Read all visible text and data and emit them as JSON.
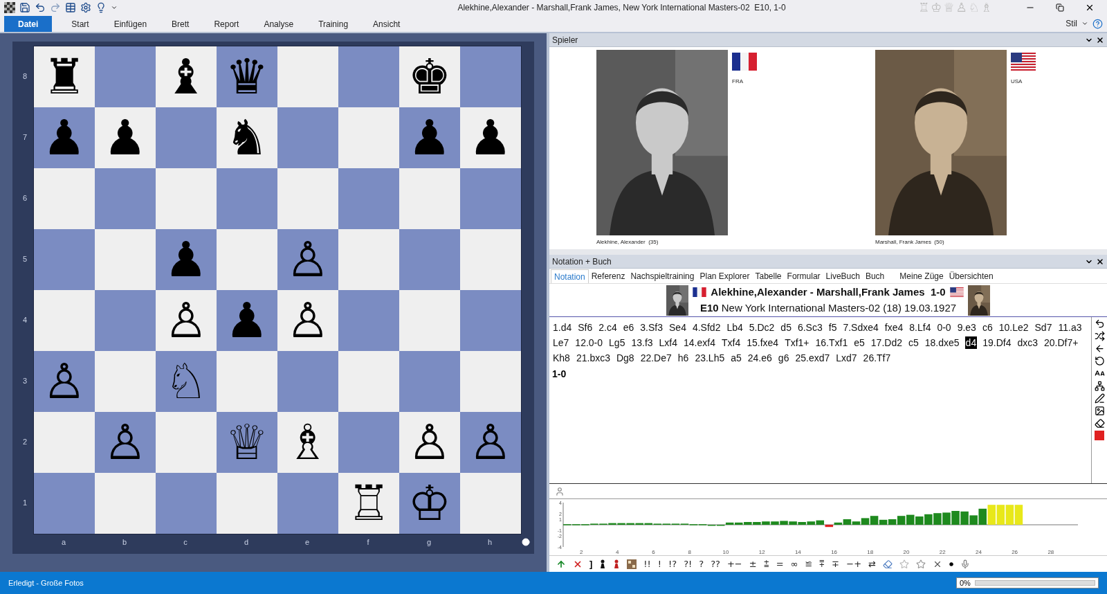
{
  "window": {
    "title": "Alekhine,Alexander - Marshall,Frank James, New York International Masters-02  E10, 1-0",
    "title_glyphs": [
      "♖",
      "♔",
      "♕",
      "♙",
      "♘",
      "♗"
    ]
  },
  "ribbon": {
    "tabs": [
      {
        "label": "Datei",
        "selected": true
      },
      {
        "label": "Start",
        "selected": false
      },
      {
        "label": "Einfügen",
        "selected": false
      },
      {
        "label": "Brett",
        "selected": false
      },
      {
        "label": "Report",
        "selected": false
      },
      {
        "label": "Analyse",
        "selected": false
      },
      {
        "label": "Training",
        "selected": false
      },
      {
        "label": "Ansicht",
        "selected": false
      }
    ],
    "style_label": "Stil"
  },
  "board": {
    "ranks": [
      "8",
      "7",
      "6",
      "5",
      "4",
      "3",
      "2",
      "1"
    ],
    "files": [
      "a",
      "b",
      "c",
      "d",
      "e",
      "f",
      "g",
      "h"
    ],
    "squares": [
      [
        {
          "color": "#efefef",
          "piece": "♜"
        },
        {
          "color": "#7b8cc2"
        },
        {
          "color": "#efefef",
          "piece": "♝"
        },
        {
          "color": "#7b8cc2",
          "piece": "♛"
        },
        {
          "color": "#efefef"
        },
        {
          "color": "#7b8cc2"
        },
        {
          "color": "#efefef",
          "piece": "♚"
        },
        {
          "color": "#7b8cc2"
        }
      ],
      [
        {
          "color": "#7b8cc2",
          "piece": "♟"
        },
        {
          "color": "#efefef",
          "piece": "♟"
        },
        {
          "color": "#7b8cc2"
        },
        {
          "color": "#efefef",
          "piece": "♞"
        },
        {
          "color": "#7b8cc2"
        },
        {
          "color": "#efefef"
        },
        {
          "color": "#7b8cc2",
          "piece": "♟"
        },
        {
          "color": "#efefef",
          "piece": "♟"
        }
      ],
      [
        {
          "color": "#efefef"
        },
        {
          "color": "#7b8cc2"
        },
        {
          "color": "#efefef"
        },
        {
          "color": "#7b8cc2"
        },
        {
          "color": "#efefef"
        },
        {
          "color": "#7b8cc2"
        },
        {
          "color": "#efefef"
        },
        {
          "color": "#7b8cc2"
        }
      ],
      [
        {
          "color": "#7b8cc2"
        },
        {
          "color": "#efefef"
        },
        {
          "color": "#7b8cc2",
          "piece": "♟"
        },
        {
          "color": "#efefef"
        },
        {
          "color": "#7b8cc2",
          "piece": "♙"
        },
        {
          "color": "#efefef"
        },
        {
          "color": "#7b8cc2"
        },
        {
          "color": "#efefef"
        }
      ],
      [
        {
          "color": "#efefef"
        },
        {
          "color": "#7b8cc2"
        },
        {
          "color": "#efefef",
          "piece": "♙"
        },
        {
          "color": "#7b8cc2",
          "piece": "♟"
        },
        {
          "color": "#efefef",
          "piece": "♙"
        },
        {
          "color": "#7b8cc2"
        },
        {
          "color": "#efefef"
        },
        {
          "color": "#7b8cc2"
        }
      ],
      [
        {
          "color": "#7b8cc2",
          "piece": "♙"
        },
        {
          "color": "#efefef"
        },
        {
          "color": "#7b8cc2",
          "piece": "♘"
        },
        {
          "color": "#efefef"
        },
        {
          "color": "#7b8cc2"
        },
        {
          "color": "#efefef"
        },
        {
          "color": "#7b8cc2"
        },
        {
          "color": "#efefef"
        }
      ],
      [
        {
          "color": "#efefef"
        },
        {
          "color": "#7b8cc2",
          "piece": "♙"
        },
        {
          "color": "#efefef"
        },
        {
          "color": "#7b8cc2",
          "piece": "♕"
        },
        {
          "color": "#efefef",
          "piece": "♗"
        },
        {
          "color": "#7b8cc2"
        },
        {
          "color": "#efefef",
          "piece": "♙"
        },
        {
          "color": "#7b8cc2",
          "piece": "♙"
        }
      ],
      [
        {
          "color": "#7b8cc2"
        },
        {
          "color": "#efefef"
        },
        {
          "color": "#7b8cc2"
        },
        {
          "color": "#efefef"
        },
        {
          "color": "#7b8cc2"
        },
        {
          "color": "#efefef",
          "piece": "♖"
        },
        {
          "color": "#7b8cc2",
          "piece": "♔"
        },
        {
          "color": "#efefef"
        }
      ]
    ]
  },
  "players_panel": {
    "title": "Spieler",
    "players": [
      {
        "caption": "Alekhine, Alexander  (35)",
        "country": "FRA",
        "flag": {
          "kind": "france"
        }
      },
      {
        "caption": "Marshall, Frank James  (50)",
        "country": "USA",
        "flag": {
          "kind": "usa"
        }
      }
    ]
  },
  "notation_panel": {
    "title": "Notation + Buch",
    "tabs": [
      {
        "label": "Notation",
        "selected": true
      },
      {
        "label": "Referenz",
        "selected": false
      },
      {
        "label": "Nachspieltraining",
        "selected": false
      },
      {
        "label": "Plan Explorer",
        "selected": false
      },
      {
        "label": "Tabelle",
        "selected": false
      },
      {
        "label": "Formular",
        "selected": false
      },
      {
        "label": "LiveBuch",
        "selected": false
      },
      {
        "label": "Buch",
        "selected": false
      },
      {
        "label": "Meine Züge",
        "selected": false
      },
      {
        "label": "Übersichten",
        "selected": false
      }
    ],
    "header": {
      "players_line": "Alekhine,Alexander - Marshall,Frank James  1-0",
      "event_line": "**E10** New York International Masters-02 (18) 19.03.1927"
    },
    "moves": [
      {
        "text": "1.d4",
        "selected": false
      },
      {
        "text": "Sf6",
        "selected": false
      },
      {
        "text": "2.c4",
        "selected": false
      },
      {
        "text": "e6",
        "selected": false
      },
      {
        "text": "3.Sf3",
        "selected": false
      },
      {
        "text": "Se4",
        "selected": false
      },
      {
        "text": "4.Sfd2",
        "selected": false
      },
      {
        "text": "Lb4",
        "selected": false
      },
      {
        "text": "5.Dc2",
        "selected": false
      },
      {
        "text": "d5",
        "selected": false
      },
      {
        "text": "6.Sc3",
        "selected": false
      },
      {
        "text": "f5",
        "selected": false
      },
      {
        "text": "7.Sdxe4",
        "selected": false
      },
      {
        "text": "fxe4",
        "selected": false
      },
      {
        "text": "8.Lf4",
        "selected": false
      },
      {
        "text": "0-0",
        "selected": false
      },
      {
        "text": "9.e3",
        "selected": false
      },
      {
        "text": "c6",
        "selected": false
      },
      {
        "text": "10.Le2",
        "selected": false
      },
      {
        "text": "Sd7",
        "selected": false
      },
      {
        "text": "11.a3",
        "selected": false
      },
      {
        "text": "Le7",
        "selected": false
      },
      {
        "text": "12.0-0",
        "selected": false
      },
      {
        "text": "Lg5",
        "selected": false
      },
      {
        "text": "13.f3",
        "selected": false
      },
      {
        "text": "Lxf4",
        "selected": false
      },
      {
        "text": "14.exf4",
        "selected": false
      },
      {
        "text": "Txf4",
        "selected": false
      },
      {
        "text": "15.fxe4",
        "selected": false
      },
      {
        "text": "Txf1+",
        "selected": false
      },
      {
        "text": "16.Txf1",
        "selected": false
      },
      {
        "text": "e5",
        "selected": false
      },
      {
        "text": "17.Dd2",
        "selected": false
      },
      {
        "text": "c5",
        "selected": false
      },
      {
        "text": "18.dxe5",
        "selected": false
      },
      {
        "text": "d4",
        "selected": true
      },
      {
        "text": "19.Df4",
        "selected": false
      },
      {
        "text": "dxc3",
        "selected": false
      },
      {
        "text": "20.Df7+",
        "selected": false
      },
      {
        "text": "Kh8",
        "selected": false
      },
      {
        "text": "21.bxc3",
        "selected": false
      },
      {
        "text": "Dg8",
        "selected": false
      },
      {
        "text": "22.De7",
        "selected": false
      },
      {
        "text": "h6",
        "selected": false
      },
      {
        "text": "23.Lh5",
        "selected": false
      },
      {
        "text": "a5",
        "selected": false
      },
      {
        "text": "24.e6",
        "selected": false
      },
      {
        "text": "g6",
        "selected": false
      },
      {
        "text": "25.exd7",
        "selected": false
      },
      {
        "text": "Lxd7",
        "selected": false
      },
      {
        "text": "26.Tf7",
        "selected": false
      }
    ],
    "result": "1-0"
  },
  "eval_graph": {
    "chart_data": {
      "type": "bar",
      "x": [
        1,
        1.5,
        2,
        2.5,
        3,
        3.5,
        4,
        4.5,
        5,
        5.5,
        6,
        6.5,
        7,
        7.5,
        8,
        8.5,
        9,
        9.5,
        10,
        10.5,
        11,
        11.5,
        12,
        12.5,
        13,
        13.5,
        14,
        14.5,
        15,
        15.5,
        16,
        16.5,
        17,
        17.5,
        18,
        18.5,
        19,
        19.5,
        20,
        20.5,
        21,
        21.5,
        22,
        22.5,
        23,
        23.5,
        24,
        24.5,
        25,
        25.5,
        26
      ],
      "series": [
        {
          "color": "#1e8a1e",
          "values": [
            0.1,
            0.1,
            0.1,
            0.2,
            0.2,
            0.3,
            0.3,
            0.3,
            0.3,
            0.3,
            0.2,
            0.2,
            0.2,
            0.2,
            0.1,
            0.1,
            0.0,
            0.0,
            0.4,
            0.4,
            0.5,
            0.5,
            0.6,
            0.6,
            0.7,
            0.6,
            0.5,
            0.6,
            0.8,
            null,
            0.4,
            1.0,
            0.6,
            1.2,
            1.6,
            0.9,
            1.0,
            1.6,
            1.8,
            1.5,
            1.9,
            2.1,
            2.2,
            2.5,
            2.4,
            1.7,
            2.9,
            null,
            null,
            null,
            null
          ]
        },
        {
          "color": "#e02020",
          "values": [
            null,
            null,
            null,
            null,
            null,
            null,
            null,
            null,
            null,
            null,
            null,
            null,
            null,
            null,
            null,
            null,
            null,
            null,
            null,
            null,
            null,
            null,
            null,
            null,
            null,
            null,
            null,
            null,
            null,
            -0.4,
            null,
            null,
            null,
            null,
            null,
            null,
            null,
            null,
            null,
            null,
            null,
            null,
            null,
            null,
            null,
            null,
            null,
            null,
            null,
            null,
            null
          ]
        },
        {
          "color": "#e8e81a",
          "values": [
            null,
            null,
            null,
            null,
            null,
            null,
            null,
            null,
            null,
            null,
            null,
            null,
            null,
            null,
            null,
            null,
            null,
            null,
            null,
            null,
            null,
            null,
            null,
            null,
            null,
            null,
            null,
            null,
            null,
            null,
            null,
            null,
            null,
            null,
            null,
            null,
            null,
            null,
            null,
            null,
            null,
            null,
            null,
            null,
            null,
            null,
            null,
            3.6,
            3.6,
            3.6,
            3.6
          ]
        }
      ],
      "xlim": [
        1,
        29.5
      ],
      "ylim": [
        -4,
        4
      ],
      "xticks": [
        2,
        4,
        6,
        8,
        10,
        12,
        14,
        16,
        18,
        20,
        22,
        24,
        26,
        28
      ],
      "yticks": [
        4,
        2,
        1,
        -1,
        -2,
        -4
      ]
    }
  },
  "annotation_bar": {
    "bracket": "]",
    "symbols": [
      "!!",
      "!",
      "!?",
      "?!",
      "?",
      "??",
      "+−",
      "±",
      "⩲",
      "=",
      "∞",
      "≌",
      "⩱",
      "∓",
      "−+",
      "⇄"
    ]
  },
  "status_bar": {
    "text": "Erledigt - Große Fotos",
    "progress": {
      "reading": "0%",
      "level": 0
    }
  }
}
